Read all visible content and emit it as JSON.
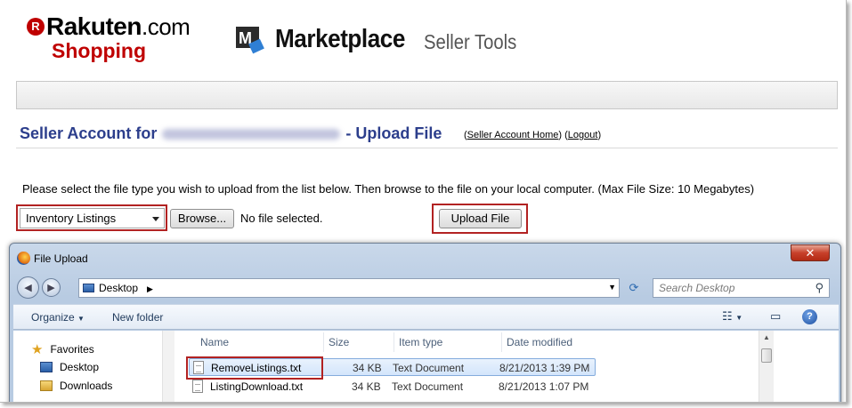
{
  "header": {
    "rakuten_brand": "Rakuten",
    "rakuten_com": ".com",
    "rakuten_shopping": "Shopping",
    "marketplace_title": "Marketplace",
    "marketplace_sub": "Seller Tools"
  },
  "page": {
    "heading_prefix": "Seller Account for",
    "heading_suffix": "- Upload File",
    "link_home": "Seller Account Home",
    "link_logout": "Logout",
    "instructions": "Please select the file type you wish to upload from the list below. Then browse to the file on your local computer. (Max File Size: 10 Megabytes)"
  },
  "form": {
    "file_type_value": "Inventory Listings",
    "browse_label": "Browse...",
    "no_file_text": "No file selected.",
    "upload_label": "Upload File"
  },
  "dialog": {
    "title": "File Upload",
    "address": "Desktop",
    "search_placeholder": "Search Desktop",
    "toolbar": {
      "organize": "Organize",
      "new_folder": "New folder"
    },
    "nav_tree": [
      {
        "label": "Favorites",
        "icon": "star-icon"
      },
      {
        "label": "Desktop",
        "icon": "desktop-folder-icon"
      },
      {
        "label": "Downloads",
        "icon": "downloads-folder-icon"
      }
    ],
    "columns": {
      "name": "Name",
      "size": "Size",
      "type": "Item type",
      "modified": "Date modified"
    },
    "files": [
      {
        "name": "RemoveListings.txt",
        "size": "34 KB",
        "type": "Text Document",
        "modified": "8/21/2013 1:39 PM"
      },
      {
        "name": "ListingDownload.txt",
        "size": "34 KB",
        "type": "Text Document",
        "modified": "8/21/2013 1:07 PM"
      }
    ]
  },
  "colors": {
    "rakuten_red": "#bf0000",
    "heading_blue": "#2c3e8c",
    "highlight_red": "#b22222"
  }
}
